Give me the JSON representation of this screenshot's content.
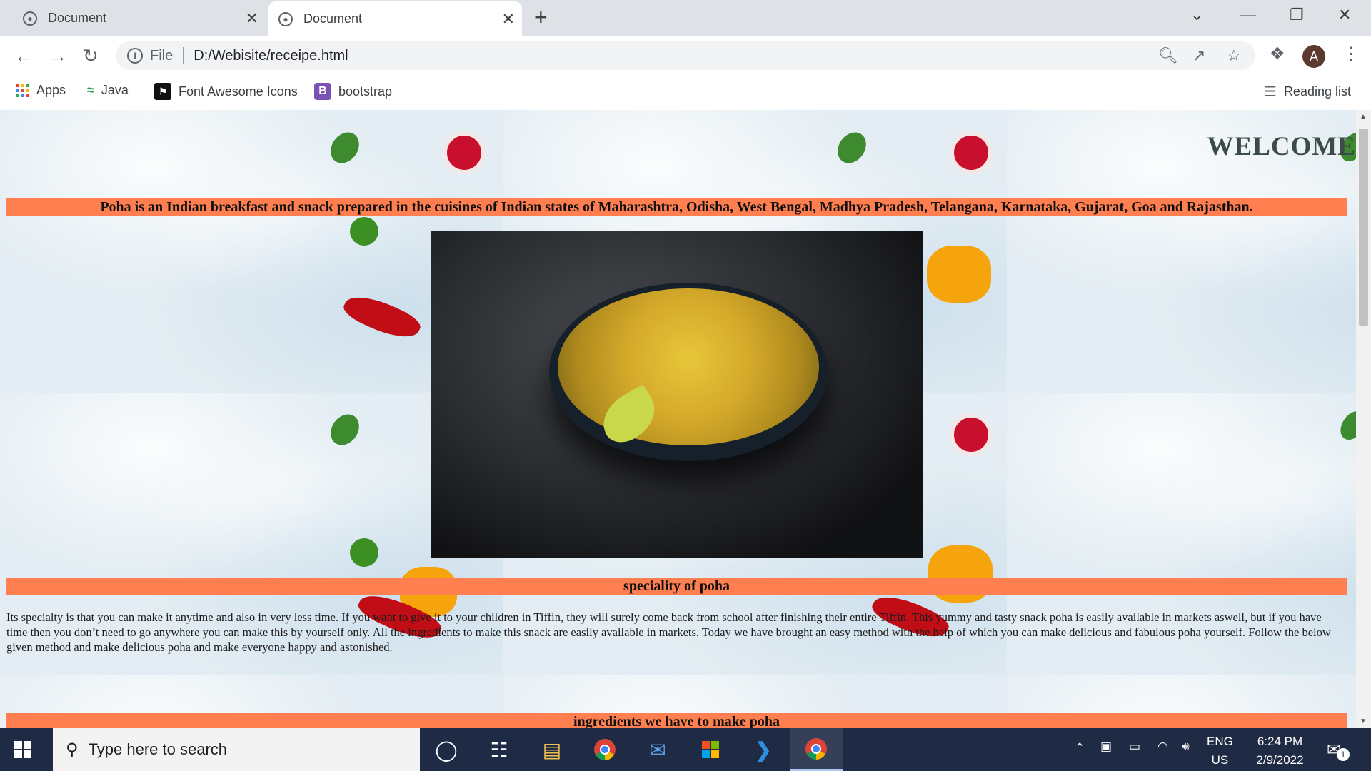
{
  "browser": {
    "tabs": [
      {
        "title": "Document",
        "active": false
      },
      {
        "title": "Document",
        "active": true
      }
    ],
    "address": {
      "scheme": "File",
      "url": "D:/Webisite/receipe.html"
    },
    "avatar_letter": "A",
    "bookmarks": [
      {
        "label": "Apps",
        "icon": "apps-grid-icon"
      },
      {
        "label": "Java",
        "icon": "java-icon"
      },
      {
        "label": "Font Awesome Icons",
        "icon": "font-awesome-flag-icon"
      },
      {
        "label": "bootstrap",
        "icon": "bootstrap-icon",
        "icon_letter": "B"
      }
    ],
    "reading_list": "Reading list"
  },
  "page": {
    "welcome": "WELCOME",
    "intro_band": "Poha is an Indian breakfast and snack prepared in the cuisines of Indian states of Maharashtra, Odisha, West Bengal, Madhya Pradesh, Telangana, Karnataka, Gujarat, Goa and Rajasthan.",
    "speciality_heading": "speciality of poha",
    "speciality_text": "Its specialty is that you can make it anytime and also in very less time. If you want to give it to your children in Tiffin, they will surely come back from school after finishing their entire Tiffin. This yummy and tasty snack poha is easily available in markets aswell, but if you have time then you don’t need to go anywhere you can make this by yourself only. All the ingredients to make this snack are easily available in markets. Today we have brought an easy method with the help of which you can make delicious and fabulous poha yourself. Follow the below given method and make delicious poha and make everyone happy and astonished.",
    "ingredients_heading": "ingredients we have to make poha",
    "band_color": "#ff7f50"
  },
  "taskbar": {
    "search_placeholder": "Type here to search",
    "language": "ENG",
    "region": "US",
    "time": "6:24 PM",
    "date": "2/9/2022",
    "notification_count": "1"
  }
}
